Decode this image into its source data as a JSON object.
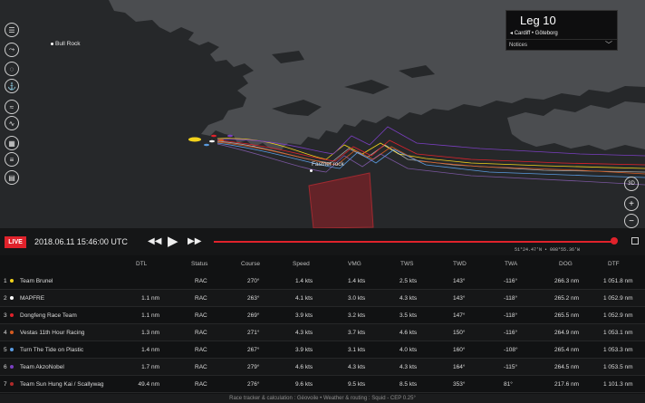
{
  "map": {
    "labels": {
      "bull_rock": "Bull Rock",
      "fastnet_rock": "Fastnet rock"
    }
  },
  "leg": {
    "title": "Leg 10",
    "route": "Cardiff • Göteborg",
    "notices": "Notices"
  },
  "controls": {
    "three_d": "3D",
    "zoom_in": "+",
    "zoom_out": "−"
  },
  "timebar": {
    "live": "LIVE",
    "datetime": "2018.06.11 15:46:00 UTC",
    "coords": "51°24.47'N • 008°55.36'W",
    "progress": 1.0
  },
  "table": {
    "headers": [
      "DTL",
      "Status",
      "Course",
      "Speed",
      "VMG",
      "TWS",
      "TWD",
      "TWA",
      "DOG",
      "DTF"
    ],
    "rows": [
      {
        "rank": "1",
        "team": "Team Brunel",
        "color": "#f2d21b",
        "dtl": "",
        "status": "RAC",
        "course": "270°",
        "speed": "1.4 kts",
        "vmg": "1.4 kts",
        "tws": "2.5 kts",
        "twd": "143°",
        "twa": "-116°",
        "dog": "266.3 nm",
        "dtf": "1 051.8 nm"
      },
      {
        "rank": "2",
        "team": "MAPFRE",
        "color": "#ffffff",
        "dtl": "1.1 nm",
        "status": "RAC",
        "course": "263°",
        "speed": "4.1 kts",
        "vmg": "3.0 kts",
        "tws": "4.3 kts",
        "twd": "143°",
        "twa": "-118°",
        "dog": "265.2 nm",
        "dtf": "1 052.9 nm"
      },
      {
        "rank": "3",
        "team": "Dongfeng Race Team",
        "color": "#e0222b",
        "dtl": "1.1 nm",
        "status": "RAC",
        "course": "269°",
        "speed": "3.9 kts",
        "vmg": "3.2 kts",
        "tws": "3.5 kts",
        "twd": "147°",
        "twa": "-118°",
        "dog": "265.5 nm",
        "dtf": "1 052.9 nm"
      },
      {
        "rank": "4",
        "team": "Vestas 11th Hour Racing",
        "color": "#d45a20",
        "dtl": "1.3 nm",
        "status": "RAC",
        "course": "271°",
        "speed": "4.3 kts",
        "vmg": "3.7 kts",
        "tws": "4.6 kts",
        "twd": "150°",
        "twa": "-116°",
        "dog": "264.9 nm",
        "dtf": "1 053.1 nm"
      },
      {
        "rank": "5",
        "team": "Turn The Tide on Plastic",
        "color": "#5a9be0",
        "dtl": "1.4 nm",
        "status": "RAC",
        "course": "267°",
        "speed": "3.9 kts",
        "vmg": "3.1 kts",
        "tws": "4.0 kts",
        "twd": "160°",
        "twa": "-108°",
        "dog": "265.4 nm",
        "dtf": "1 053.3 nm"
      },
      {
        "rank": "6",
        "team": "Team AkzoNobel",
        "color": "#7a3fc0",
        "dtl": "1.7 nm",
        "status": "RAC",
        "course": "279°",
        "speed": "4.6 kts",
        "vmg": "4.3 kts",
        "tws": "4.3 kts",
        "twd": "164°",
        "twa": "-115°",
        "dog": "264.5 nm",
        "dtf": "1 053.5 nm"
      },
      {
        "rank": "7",
        "team": "Team Sun Hung Kai / Scallywag",
        "color": "#b02a2a",
        "dtl": "49.4 nm",
        "status": "RAC",
        "course": "276°",
        "speed": "9.6 kts",
        "vmg": "9.5 kts",
        "tws": "8.5 kts",
        "twd": "353°",
        "twa": "81°",
        "dog": "217.6 nm",
        "dtf": "1 101.3 nm"
      }
    ]
  },
  "footer": "Race tracker & calculation : Géovoile • Weather & routing : Squid - CEP 0.25°",
  "colors": {
    "accent": "#e0222b",
    "map_sea": "#26282a",
    "map_land": "#4a4c4f"
  }
}
